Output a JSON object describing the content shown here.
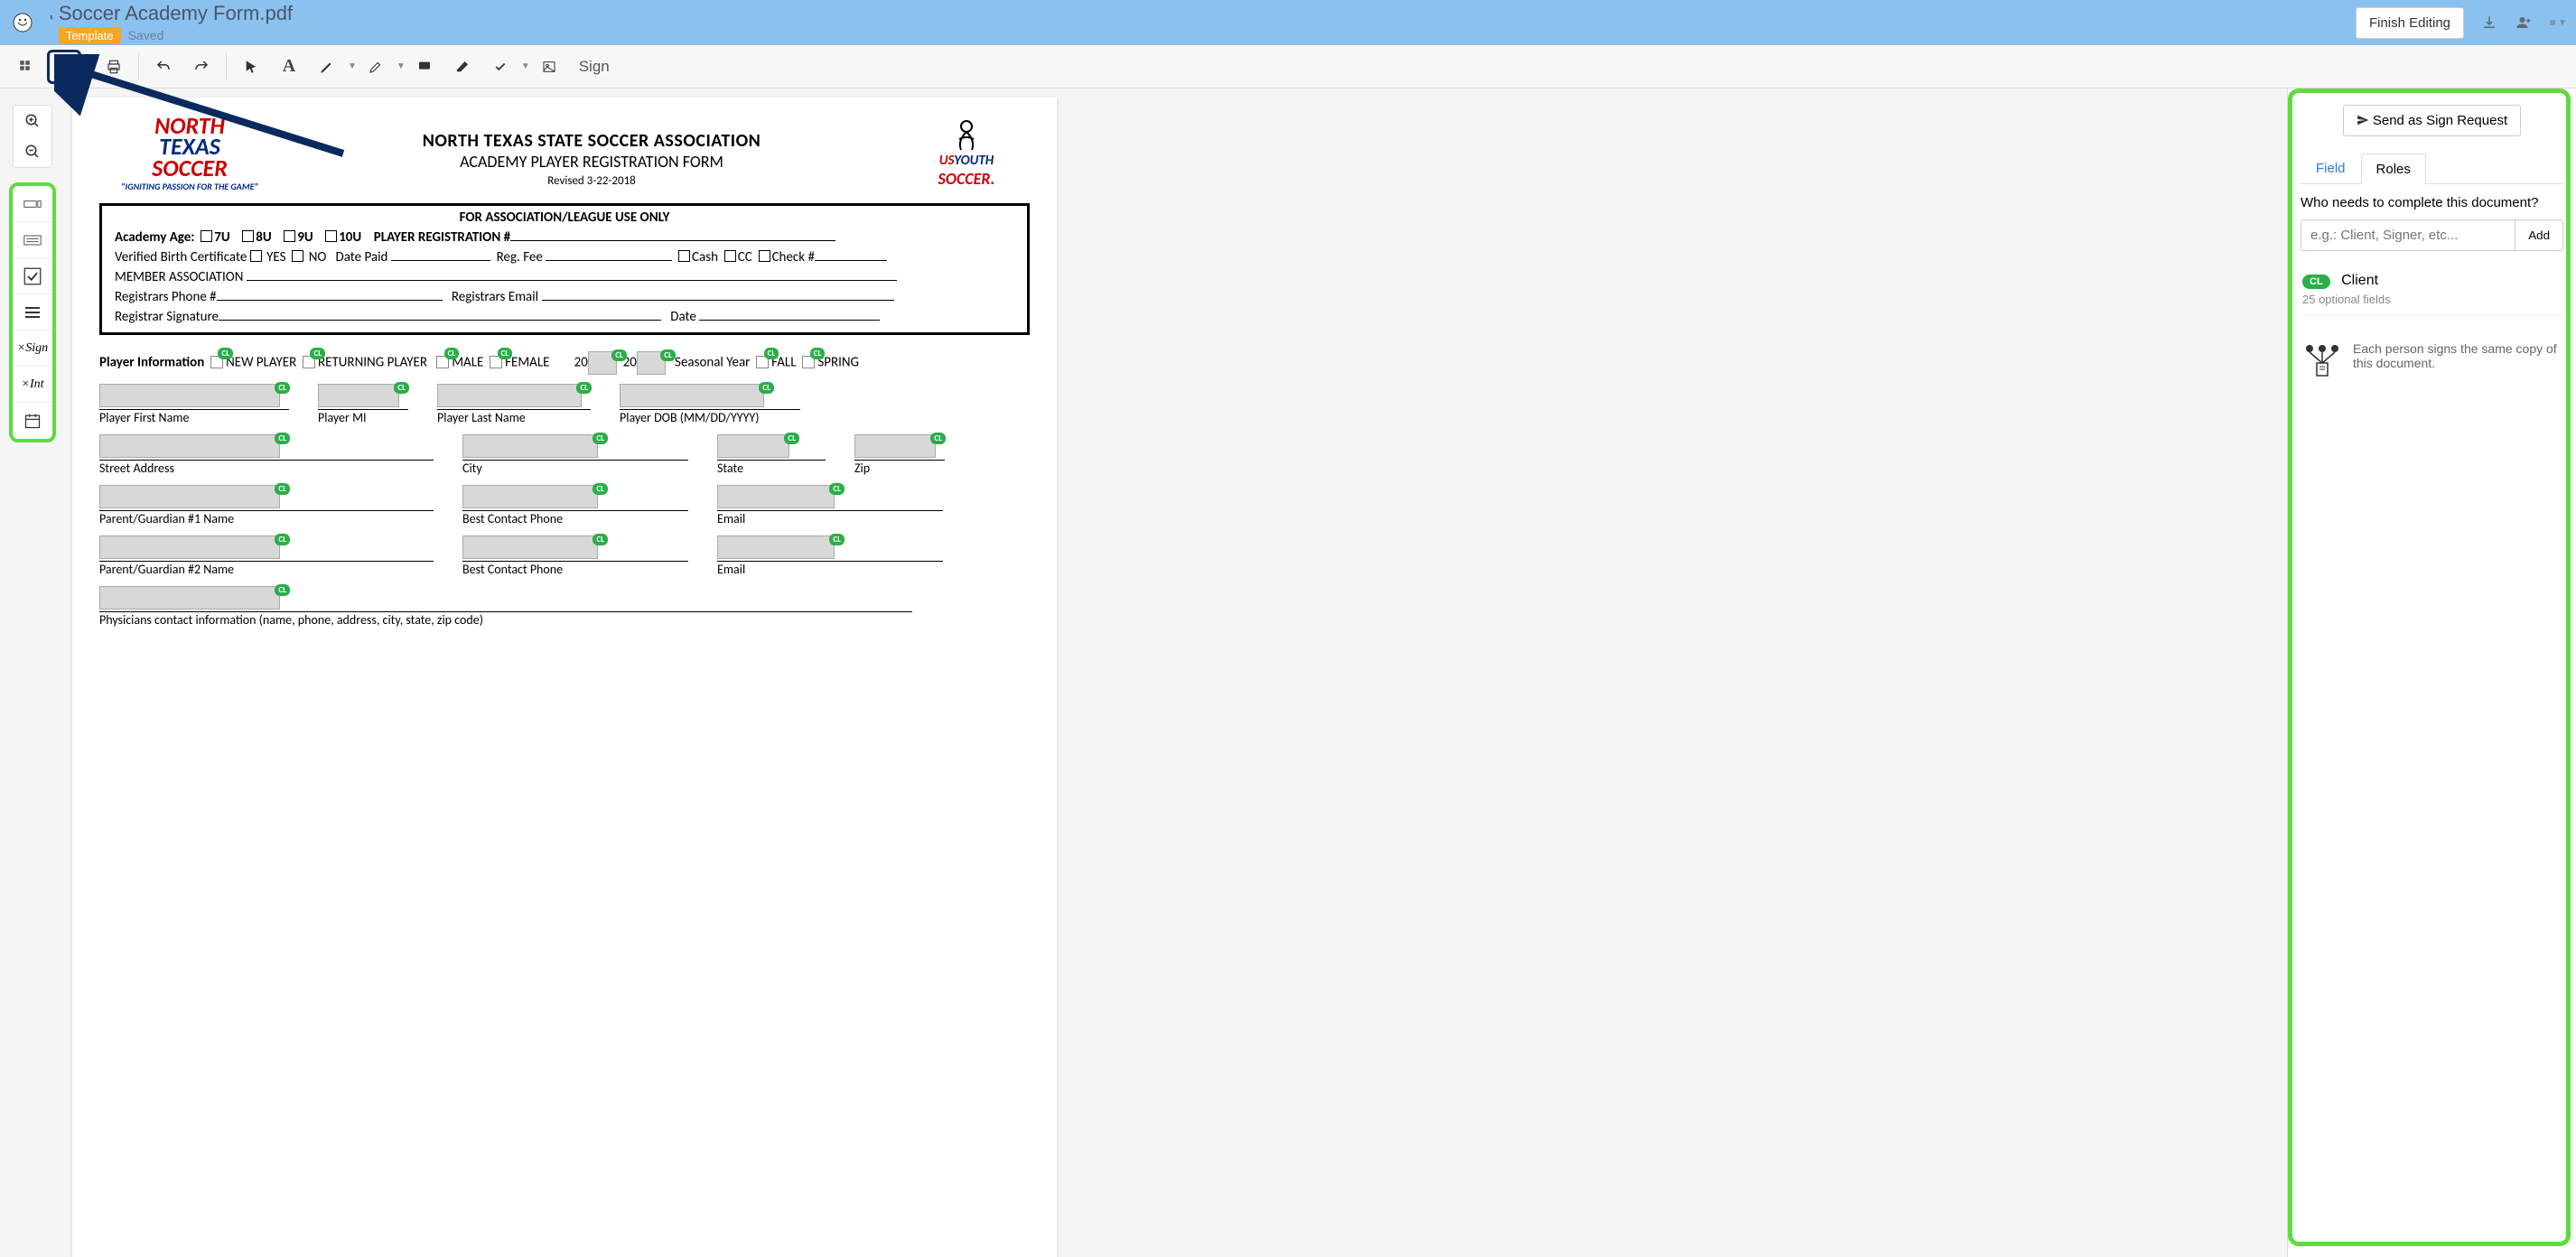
{
  "header": {
    "doc_title": "Soccer Academy Form.pdf",
    "template_tag": "Template",
    "saved_tag": "Saved",
    "finish_btn": "Finish Editing"
  },
  "toolbar": {
    "sign": "Sign"
  },
  "document": {
    "org_title_line1": "NORTH TEXAS STATE SOCCER ASSOCIATION",
    "org_title_line2": "ACADEMY PLAYER REGISTRATION FORM",
    "revised": "Revised  3-22-2018",
    "logo_left": {
      "l1": "NORTH",
      "l2": "TEXAS",
      "l3": "SOCCER",
      "tagline": "\"IGNITING PASSION FOR THE GAME\""
    },
    "logo_right": {
      "l1": "US",
      "l2": "YOUTH",
      "l3": "SOCCER."
    },
    "assoc_box": {
      "header": "FOR ASSOCIATION/LEAGUE USE ONLY",
      "line1_pre": "Academy Age:",
      "age_7u": "7U",
      "age_8u": "8U",
      "age_9u": "9U",
      "age_10u": "10U",
      "reg_num": "PLAYER REGISTRATION #",
      "line2_cert": "Verified Birth Certificate",
      "yes": "YES",
      "no": "NO",
      "date_paid": "Date Paid",
      "reg_fee": "Reg. Fee",
      "cash": "Cash",
      "cc": "CC",
      "check": "Check #",
      "member_assoc": "MEMBER ASSOCIATION",
      "reg_phone": "Registrars Phone #",
      "reg_email": "Registrars Email",
      "reg_sig": "Registrar Signature",
      "date": "Date"
    },
    "player_info": {
      "label": "Player Information",
      "new_player": "NEW PLAYER",
      "returning": "RETURNING PLAYER",
      "male": "MALE",
      "female": "FEMALE",
      "twenty_a": "20",
      "twenty_b": "20",
      "seasonal": "Seasonal Year",
      "fall": "FALL",
      "spring": "SPRING",
      "first_name": "Player First Name",
      "mi": "Player MI",
      "last_name": "Player Last Name",
      "dob": "Player DOB (MM/DD/YYYY)",
      "street": "Street Address",
      "city": "City",
      "state": "State",
      "zip": "Zip",
      "pg1": "Parent/Guardian #1 Name",
      "phone": "Best Contact Phone",
      "email": "Email",
      "pg2": "Parent/Guardian #2 Name",
      "physician": "Physicians contact information (name, phone, address, city, state, zip code)"
    },
    "cl_badge": "CL"
  },
  "right_panel": {
    "send_btn": "Send as Sign Request",
    "tab_field": "Field",
    "tab_roles": "Roles",
    "question": "Who needs to complete this document?",
    "placeholder": "e.g.: Client, Signer, etc...",
    "add_btn": "Add",
    "role": {
      "badge": "CL",
      "name": "Client",
      "sub": "25 optional fields"
    },
    "note": "Each person signs the same copy of this document."
  }
}
